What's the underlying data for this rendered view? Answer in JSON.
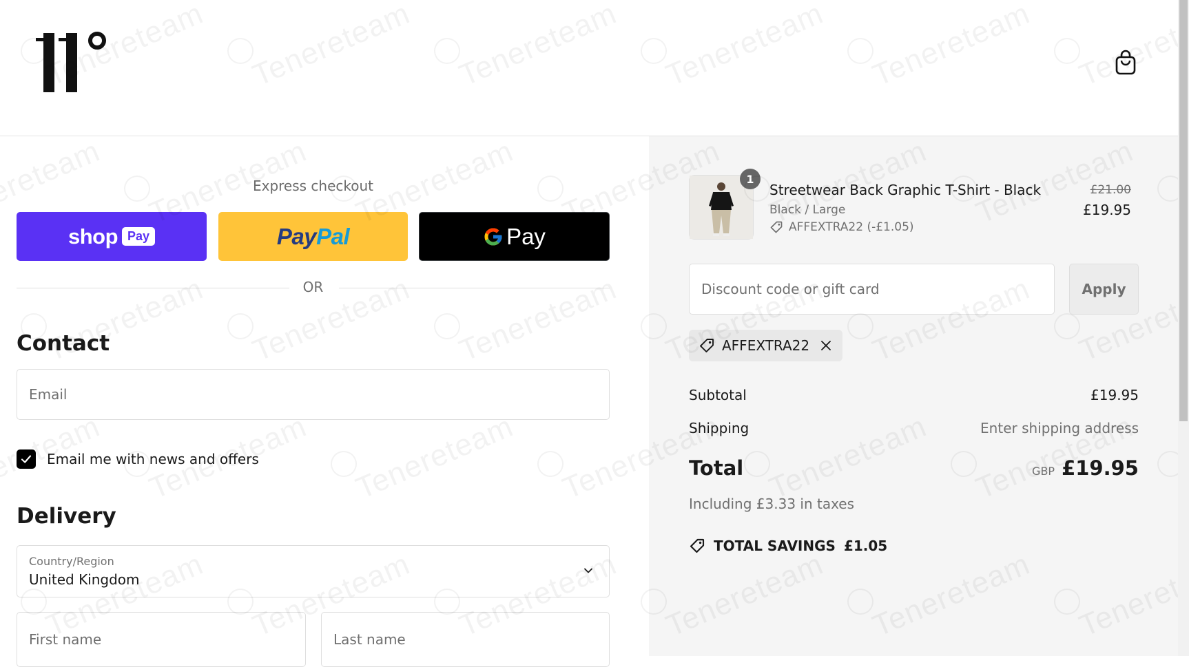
{
  "header": {
    "logo_alt": "11°",
    "cart_icon": "shopping-bag-icon"
  },
  "express": {
    "title": "Express checkout",
    "buttons": [
      {
        "id": "shop-pay",
        "label_main": "shop",
        "label_pill": "Pay",
        "bg": "#5a31f4"
      },
      {
        "id": "paypal",
        "label_a": "Pay",
        "label_b": "Pal",
        "bg": "#ffc439"
      },
      {
        "id": "google-pay",
        "label": "Pay",
        "bg": "#000000"
      }
    ],
    "or_label": "OR"
  },
  "contact": {
    "title": "Contact",
    "email_placeholder": "Email",
    "newsletter_label": "Email me with news and offers",
    "newsletter_checked": true
  },
  "delivery": {
    "title": "Delivery",
    "country_label": "Country/Region",
    "country_value": "United Kingdom",
    "first_name_placeholder": "First name",
    "last_name_placeholder": "Last name"
  },
  "order": {
    "item": {
      "quantity": "1",
      "name": "Streetwear Back Graphic T-Shirt - Black",
      "variant": "Black / Large",
      "discount": "AFFEXTRA22 (-£1.05)",
      "price_original": "£21.00",
      "price_final": "£19.95"
    },
    "discount_placeholder": "Discount code or gift card",
    "apply_label": "Apply",
    "applied_code": "AFFEXTRA22",
    "subtotal_label": "Subtotal",
    "subtotal_value": "£19.95",
    "shipping_label": "Shipping",
    "shipping_value": "Enter shipping address",
    "total_label": "Total",
    "total_currency": "GBP",
    "total_value": "£19.95",
    "tax_note": "Including £3.33 in taxes",
    "savings_label": "TOTAL SAVINGS",
    "savings_value": "£1.05"
  },
  "watermark": "Tenereteam",
  "colors": {
    "shop_pay": "#5a31f4",
    "paypal": "#ffc439",
    "paypal_dark": "#253b80",
    "paypal_light": "#179bd7",
    "summary_bg": "#f5f5f5"
  }
}
